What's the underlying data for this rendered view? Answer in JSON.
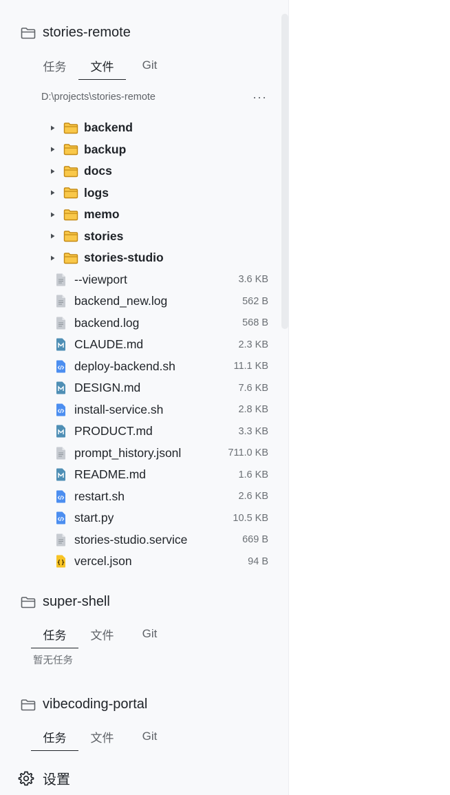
{
  "projects": [
    {
      "name": "stories-remote",
      "tabs": [
        "任务",
        "文件",
        "Git"
      ],
      "active_tab": 1,
      "path": "D:\\projects\\stories-remote",
      "more_label": "···",
      "folders": [
        "backend",
        "backup",
        "docs",
        "logs",
        "memo",
        "stories",
        "stories-studio"
      ],
      "files": [
        {
          "name": "--viewport",
          "size": "3.6 KB",
          "icon": "text-file-icon"
        },
        {
          "name": "backend_new.log",
          "size": "562 B",
          "icon": "text-file-icon"
        },
        {
          "name": "backend.log",
          "size": "568 B",
          "icon": "text-file-icon"
        },
        {
          "name": "CLAUDE.md",
          "size": "2.3 KB",
          "icon": "markdown-file-icon"
        },
        {
          "name": "deploy-backend.sh",
          "size": "11.1 KB",
          "icon": "code-file-icon"
        },
        {
          "name": "DESIGN.md",
          "size": "7.6 KB",
          "icon": "markdown-file-icon"
        },
        {
          "name": "install-service.sh",
          "size": "2.8 KB",
          "icon": "code-file-icon"
        },
        {
          "name": "PRODUCT.md",
          "size": "3.3 KB",
          "icon": "markdown-file-icon"
        },
        {
          "name": "prompt_history.jsonl",
          "size": "711.0 KB",
          "icon": "text-file-icon"
        },
        {
          "name": "README.md",
          "size": "1.6 KB",
          "icon": "markdown-file-icon"
        },
        {
          "name": "restart.sh",
          "size": "2.6 KB",
          "icon": "code-file-icon"
        },
        {
          "name": "start.py",
          "size": "10.5 KB",
          "icon": "code-file-icon"
        },
        {
          "name": "stories-studio.service",
          "size": "669 B",
          "icon": "text-file-icon"
        },
        {
          "name": "vercel.json",
          "size": "94 B",
          "icon": "json-file-icon"
        }
      ]
    },
    {
      "name": "super-shell",
      "tabs": [
        "任务",
        "文件",
        "Git"
      ],
      "active_tab": 0,
      "empty_text": "暂无任务"
    },
    {
      "name": "vibecoding-portal",
      "tabs": [
        "任务",
        "文件",
        "Git"
      ],
      "active_tab": 0
    }
  ],
  "settings": {
    "label": "设置"
  },
  "colors": {
    "folder_fill": "#f9c84a",
    "folder_stroke": "#c48a14",
    "markdown_icon": "#4f8fb5",
    "code_icon": "#4c8ef0",
    "json_icon": "#f7c325",
    "text_icon": "#c7cbd1",
    "sidebar_bg": "#f8f9fb"
  }
}
